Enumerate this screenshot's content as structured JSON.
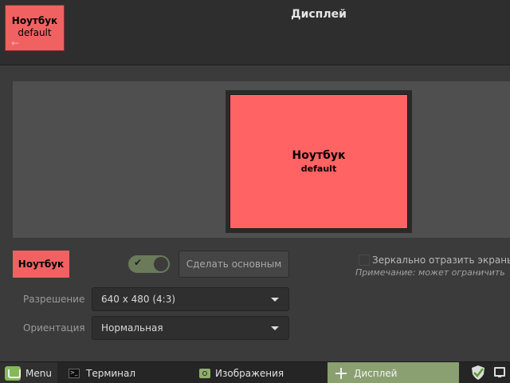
{
  "window": {
    "title": "Дисплей"
  },
  "identify_badge": {
    "name": "Ноутбук",
    "sub": "default"
  },
  "monitor": {
    "name": "Ноутбук",
    "sub": "default"
  },
  "controls": {
    "display_button": "Ноутбук",
    "primary_button": "Сделать основным",
    "enabled": true,
    "mirror_label": "Зеркально отразить экраны",
    "mirror_checked": false,
    "note": "Примечание: может ограничить",
    "resolution_label": "Разрешение",
    "resolution_value": "640 x 480 (4:3)",
    "orientation_label": "Ориентация",
    "orientation_value": "Нормальная"
  },
  "taskbar": {
    "menu_label": "Menu",
    "items": [
      {
        "label": "Терминал",
        "icon": "terminal-icon",
        "active": false
      },
      {
        "label": "Изображения",
        "icon": "image-viewer-icon",
        "active": false
      },
      {
        "label": "Дисплей",
        "icon": "display-icon",
        "active": true
      }
    ],
    "accent": "#8aa070"
  },
  "colors": {
    "display_red": "#ff6363",
    "background": "#3b3b3b"
  }
}
